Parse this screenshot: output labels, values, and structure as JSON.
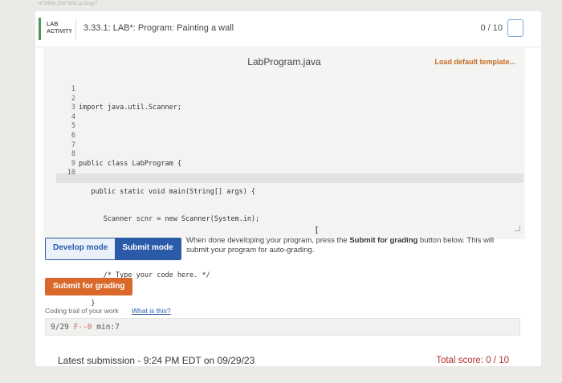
{
  "top_id": "472498.3087608.qx3zqy7",
  "header": {
    "badge_line1": "LAB",
    "badge_line2": "ACTIVITY",
    "title": "3.33.1: LAB*: Program: Painting a wall",
    "score": "0 / 10"
  },
  "editor": {
    "file_name": "LabProgram.java",
    "load_template": "Load default template...",
    "line_numbers": [
      "1",
      "2",
      "3",
      "4",
      "5",
      "6",
      "7",
      "8",
      "9",
      "10"
    ],
    "lines": [
      "import java.util.Scanner;",
      "",
      "public class LabProgram {",
      "   public static void main(String[] args) {",
      "      Scanner scnr = new Scanner(System.in);",
      "",
      "      /* Type your code here. */",
      "   }",
      "}",
      ""
    ]
  },
  "modes": {
    "develop": "Develop mode",
    "submit": "Submit mode",
    "desc_before": "When done developing your program, press the ",
    "desc_bold": "Submit for grading",
    "desc_after": " button below. This will submit your program for auto-grading."
  },
  "submit_button": "Submit for grading",
  "trail": {
    "label": "Coding trail of your work",
    "link": "What is this?",
    "date": "9/29",
    "mark": "F--0",
    "rest": "min:7"
  },
  "footer": {
    "latest": "Latest submission - 9:24 PM EDT on 09/29/23",
    "total": "Total score: 0 / 10"
  },
  "colors": {
    "accent": "#4a9a5a",
    "primary": "#2a5aa8",
    "submit": "#d9692b",
    "link_orange": "#c46a1f",
    "score_red": "#b03232"
  }
}
